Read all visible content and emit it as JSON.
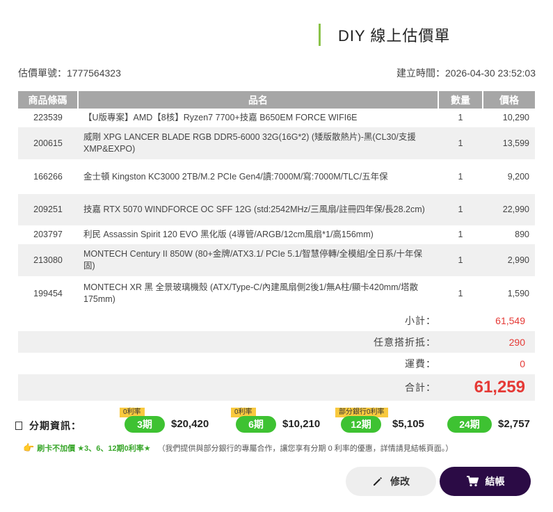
{
  "header": {
    "title": "DIY 線上估價單"
  },
  "meta": {
    "quote_number": "估價單號：1777564323",
    "created_time": "建立時間：2026-04-30 23:52:03"
  },
  "table": {
    "headers": {
      "id": "商品條碼",
      "name": "品名",
      "qty": "數量",
      "price": "價格"
    },
    "rows": [
      {
        "id": "223539",
        "name": "【U版專案】AMD【8核】Ryzen7 7700+技嘉 B650EM FORCE WIFI6E",
        "qty": "1",
        "price": "10,290"
      },
      {
        "id": "200615",
        "name": "威剛 XPG LANCER BLADE RGB DDR5-6000 32G(16G*2) (矮版散熱片)-黑(CL30/支援XMP&EXPO)",
        "qty": "1",
        "price": "13,599"
      },
      {
        "id": "166266",
        "name": "金士頓 Kingston KC3000 2TB/M.2 PCIe Gen4/讀:7000M/寫:7000M/TLC/五年保",
        "qty": "1",
        "price": "9,200"
      },
      {
        "id": "209251",
        "name": "技嘉 RTX 5070 WINDFORCE OC SFF 12G (std:2542MHz/三風扇/註冊四年保/長28.2cm)",
        "qty": "1",
        "price": "22,990"
      },
      {
        "id": "203797",
        "name": "利民 Assassin Spirit 120 EVO 黑化版 (4導管/ARGB/12cm風扇*1/高156mm)",
        "qty": "1",
        "price": "890"
      },
      {
        "id": "213080",
        "name": "MONTECH Century II 850W (80+金牌/ATX3.1/ PCIe 5.1/智慧停轉/全模組/全日系/十年保固)",
        "qty": "1",
        "price": "2,990"
      },
      {
        "id": "199454",
        "name": "MONTECH XR 黑 全景玻璃機殼 (ATX/Type-C/內建風扇側2後1/無A柱/顯卡420mm/塔散175mm)",
        "qty": "1",
        "price": "1,590"
      }
    ]
  },
  "summary": {
    "subtotal_label": "小計：",
    "subtotal_value": "61,549",
    "discount_label": "任意搭折抵：",
    "discount_value": "290",
    "shipping_label": "運費：",
    "shipping_value": "0",
    "total_label": "合計：",
    "total_value": "61,259"
  },
  "installment": {
    "title": "分期資訊：",
    "plans": [
      {
        "badge": "0利率",
        "label": "3期",
        "amount": "$20,420"
      },
      {
        "badge": "0利率",
        "label": "6期",
        "amount": "$10,210"
      },
      {
        "badge": "部分銀行0利率",
        "label": "12期",
        "amount": "$5,105"
      },
      {
        "badge": "",
        "label": "24期",
        "amount": "$2,757"
      }
    ]
  },
  "promo": {
    "highlight": "刷卡不加價 ★3、6、12期0利率★",
    "note": "（我們提供與部分銀行的專屬合作，讓您享有分期 0 利率的優惠，詳情請見結帳頁面。）"
  },
  "buttons": {
    "edit": "修改",
    "checkout": "結帳"
  },
  "colors": {
    "accent_green": "#3ec232",
    "badge_yellow": "#f9c93e",
    "total_red": "#e53935",
    "checkout_bg": "#2b0b45"
  },
  "icons": {
    "edit": "pencil-icon",
    "checkout": "cart-icon",
    "promo": "pointing-hand-icon",
    "checkbox": "checkbox-icon"
  }
}
